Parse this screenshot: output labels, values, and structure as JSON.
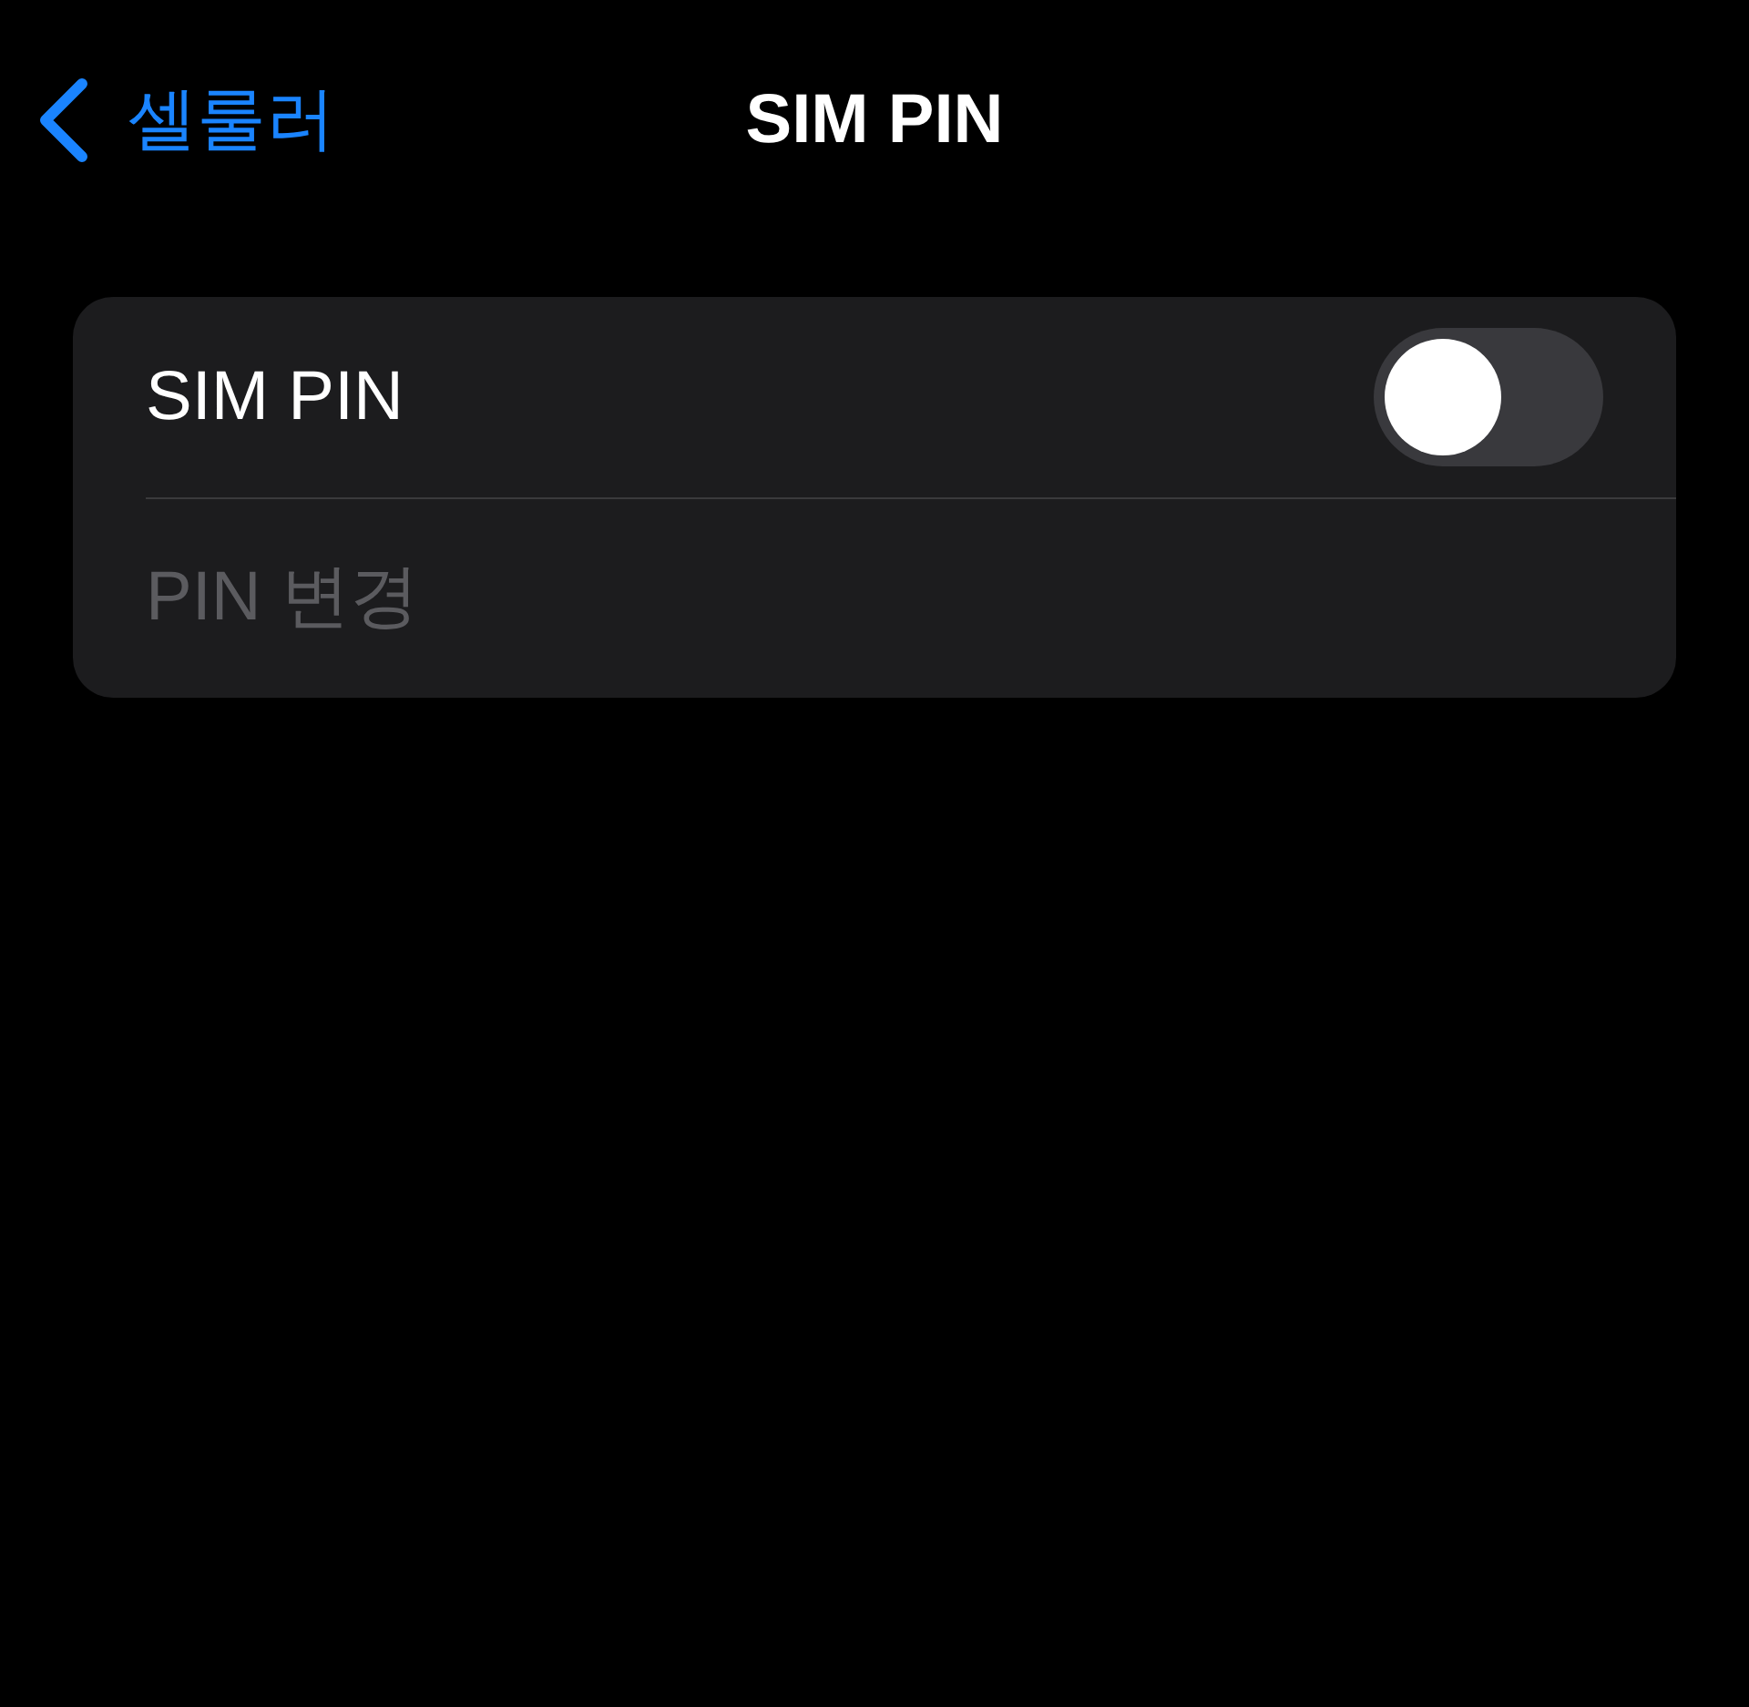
{
  "nav": {
    "back_label": "셀룰러",
    "title": "SIM PIN"
  },
  "rows": [
    {
      "kind": "toggle",
      "label": "SIM PIN",
      "on": false
    },
    {
      "kind": "action",
      "label": "PIN 변경",
      "disabled": true
    }
  ]
}
